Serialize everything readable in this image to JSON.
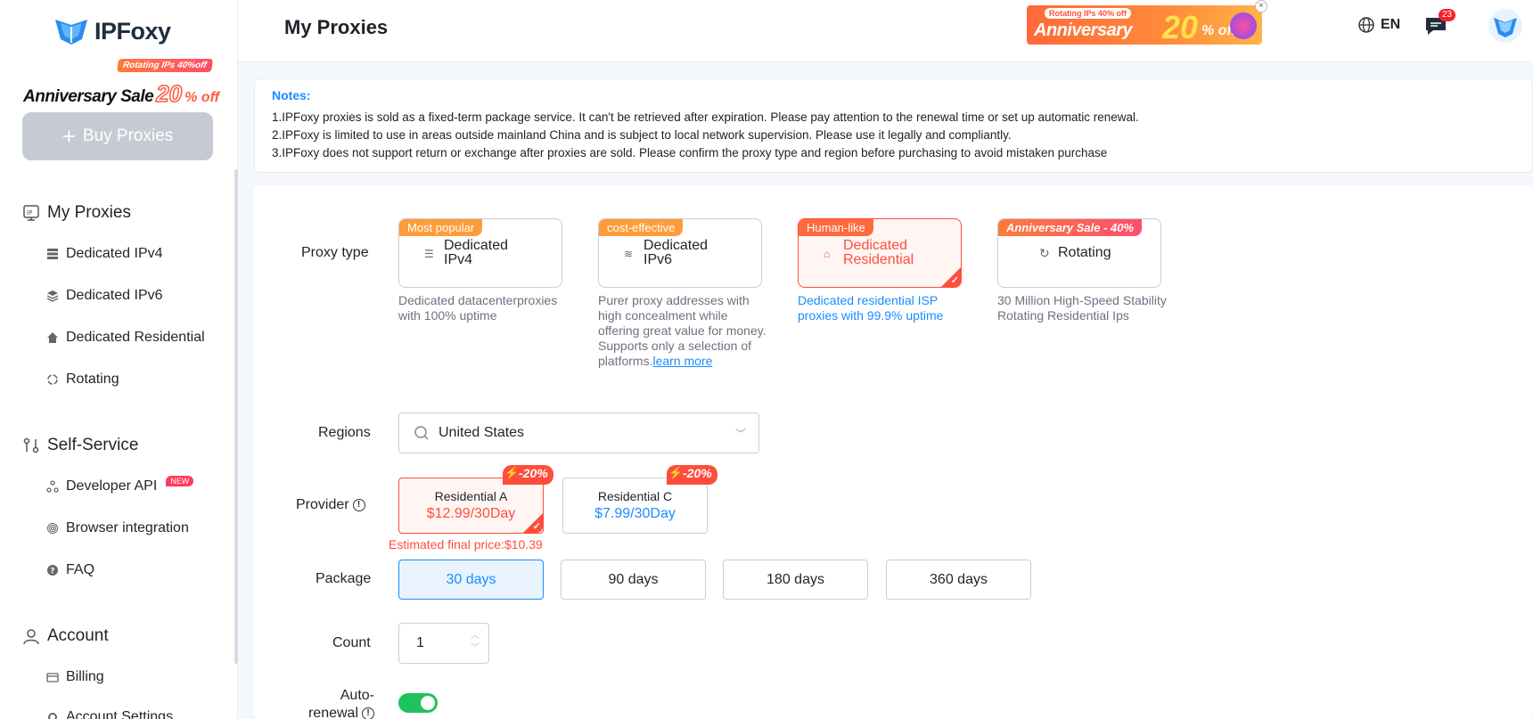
{
  "brand": {
    "name": "IPFoxy",
    "promo_tag": "Rotating IPs 40%off",
    "promo_sale_text": "Anniversary Sale",
    "promo_sale_percent": "20",
    "promo_sale_off": "% off"
  },
  "sidebar": {
    "buy_button": "Buy Proxies",
    "sections": [
      {
        "label": "My Proxies",
        "icon": "ip-icon"
      },
      {
        "label": "Self-Service",
        "icon": "workflow-icon"
      },
      {
        "label": "Account",
        "icon": "user-icon"
      }
    ],
    "my_proxies_items": [
      {
        "label": "Dedicated IPv4",
        "icon": "server-icon"
      },
      {
        "label": "Dedicated IPv6",
        "icon": "layers-icon"
      },
      {
        "label": "Dedicated Residential",
        "icon": "home-icon"
      },
      {
        "label": "Rotating",
        "icon": "rotate-icon"
      }
    ],
    "self_service_items": [
      {
        "label": "Developer API",
        "icon": "api-icon",
        "badge": "NEW"
      },
      {
        "label": "Browser integration",
        "icon": "fingerprint-icon"
      },
      {
        "label": "FAQ",
        "icon": "question-icon"
      }
    ],
    "account_items": [
      {
        "label": "Billing",
        "icon": "billing-icon"
      },
      {
        "label": "Account Settings",
        "icon": "settings-icon"
      }
    ]
  },
  "header": {
    "title": "My Proxies",
    "banner": {
      "tag": "Rotating IPs 40% off",
      "text": "Anniversary",
      "percent": "20",
      "off": "% off"
    },
    "language": "EN",
    "message_count": "23"
  },
  "notes": {
    "title": "Notes:",
    "lines": [
      "1.IPFoxy proxies is sold as a fixed-term package service. It can't be retrieved after expiration. Please pay attention to the renewal time or set up automatic renewal.",
      "2.IPFoxy is limited to use in areas outside mainland China and is subject to local network supervision. Please use it legally and compliantly.",
      "3.IPFoxy does not support return or exchange after proxies are sold. Please confirm the proxy type and region before purchasing to avoid mistaken purchase"
    ]
  },
  "form": {
    "proxy_type_label": "Proxy type",
    "proxy_types": [
      {
        "tag": "Most popular",
        "name": "Dedicated IPv4",
        "desc": "Dedicated datacenterproxies with 100% uptime",
        "selected": false
      },
      {
        "tag": "cost-effective",
        "name": "Dedicated IPv6",
        "desc": "Purer proxy addresses with high concealment while offering great value for money. Supports only a selection of platforms.",
        "link": "learn more",
        "selected": false
      },
      {
        "tag": "Human-like",
        "name": "Dedicated Residential",
        "desc": "Dedicated residential ISP proxies with 99.9% uptime",
        "selected": true
      },
      {
        "tag": "Anniversary Sale - 40%",
        "name": "Rotating",
        "desc": "30 Million High-Speed Stability Rotating Residential Ips",
        "selected": false
      }
    ],
    "regions_label": "Regions",
    "region_value": "United States",
    "provider_label": "Provider",
    "providers": [
      {
        "name": "Residential A",
        "price": "$12.99/30Day",
        "discount": "-20%",
        "selected": true
      },
      {
        "name": "Residential C",
        "price": "$7.99/30Day",
        "discount": "-20%",
        "selected": false
      }
    ],
    "estimated_price": "Estimated final price:$10.39",
    "package_label": "Package",
    "packages": [
      {
        "label": "30 days",
        "selected": true
      },
      {
        "label": "90 days",
        "selected": false
      },
      {
        "label": "180 days",
        "selected": false
      },
      {
        "label": "360 days",
        "selected": false
      }
    ],
    "count_label": "Count",
    "count_value": "1",
    "auto_renewal_label": "Auto-renewal",
    "auto_renewal_on": true
  },
  "colors": {
    "accent_blue": "#1a8cff",
    "accent_red": "#ff4d3c",
    "toggle_green": "#1fc25c"
  }
}
